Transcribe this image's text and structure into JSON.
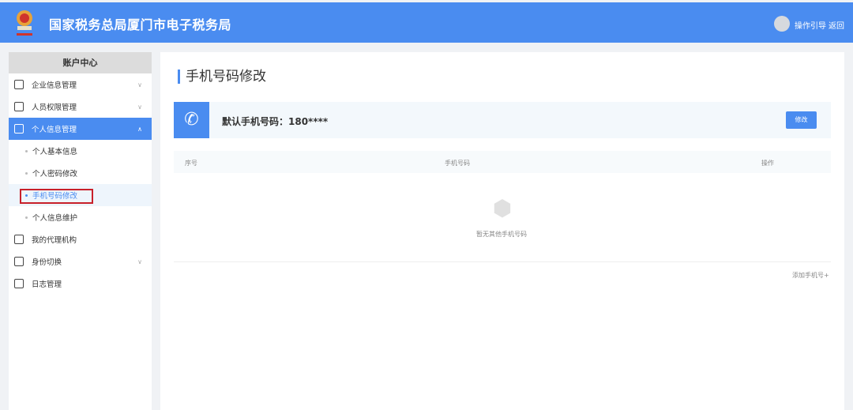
{
  "header": {
    "title": "国家税务总局厦门市电子税务局",
    "guide": "操作引导",
    "back": "返回",
    "accent": "#4a8cf0"
  },
  "sidebar": {
    "title": "账户中心",
    "items": [
      {
        "label": "企业信息管理",
        "icon": "building-icon",
        "expandable": true
      },
      {
        "label": "人员权限管理",
        "icon": "user-lock-icon",
        "expandable": true
      },
      {
        "label": "个人信息管理",
        "icon": "profile-card-icon",
        "expandable": true,
        "active": true,
        "children": [
          {
            "label": "个人基本信息"
          },
          {
            "label": "个人密码修改"
          },
          {
            "label": "手机号码修改",
            "selected": true
          },
          {
            "label": "个人信息维护"
          }
        ]
      },
      {
        "label": "我的代理机构",
        "icon": "agency-icon"
      },
      {
        "label": "身份切换",
        "icon": "switch-icon",
        "expandable": true
      },
      {
        "label": "日志管理",
        "icon": "log-icon"
      }
    ]
  },
  "main": {
    "title": "手机号码修改",
    "default_phone": "默认手机号码：180****",
    "edit_label": "修改",
    "columns": [
      "序号",
      "手机号码",
      "操作"
    ],
    "empty_text": "暂无其他手机号码",
    "add_label": "添加手机号+"
  }
}
